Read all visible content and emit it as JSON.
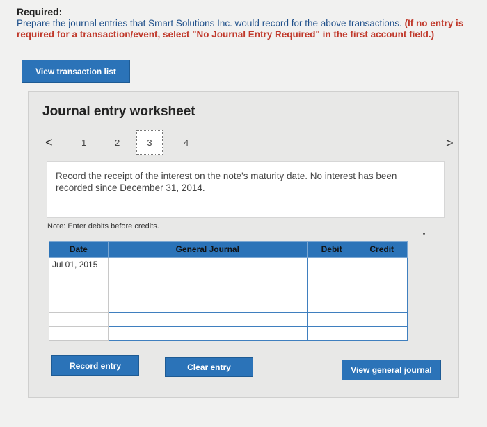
{
  "required": {
    "title": "Required:",
    "text": "Prepare the journal entries that Smart Solutions Inc. would record for the above transactions.",
    "emphasis": "(If no entry is required for a transaction/event, select \"No Journal Entry Required\" in the first account field.)"
  },
  "buttons": {
    "view_transaction_list": "View transaction list",
    "record_entry": "Record entry",
    "clear_entry": "Clear entry",
    "view_general_journal": "View general journal"
  },
  "worksheet": {
    "title": "Journal entry worksheet",
    "nav": {
      "prev": "<",
      "next": ">",
      "pages": [
        "1",
        "2",
        "3",
        "4"
      ],
      "current": "3"
    },
    "description": "Record the receipt of the interest on the note's maturity date. No interest has been recorded since December 31, 2014.",
    "note": "Note: Enter debits before credits."
  },
  "table": {
    "headers": {
      "date": "Date",
      "journal": "General Journal",
      "debit": "Debit",
      "credit": "Credit"
    },
    "rows": [
      {
        "date": "Jul 01, 2015",
        "journal": "",
        "debit": "",
        "credit": ""
      },
      {
        "date": "",
        "journal": "",
        "debit": "",
        "credit": ""
      },
      {
        "date": "",
        "journal": "",
        "debit": "",
        "credit": ""
      },
      {
        "date": "",
        "journal": "",
        "debit": "",
        "credit": ""
      },
      {
        "date": "",
        "journal": "",
        "debit": "",
        "credit": ""
      },
      {
        "date": "",
        "journal": "",
        "debit": "",
        "credit": ""
      }
    ]
  },
  "colors": {
    "accent_blue": "#2b73b8",
    "instruction_blue": "#1d4e89",
    "emphasis_red": "#c0392b"
  }
}
